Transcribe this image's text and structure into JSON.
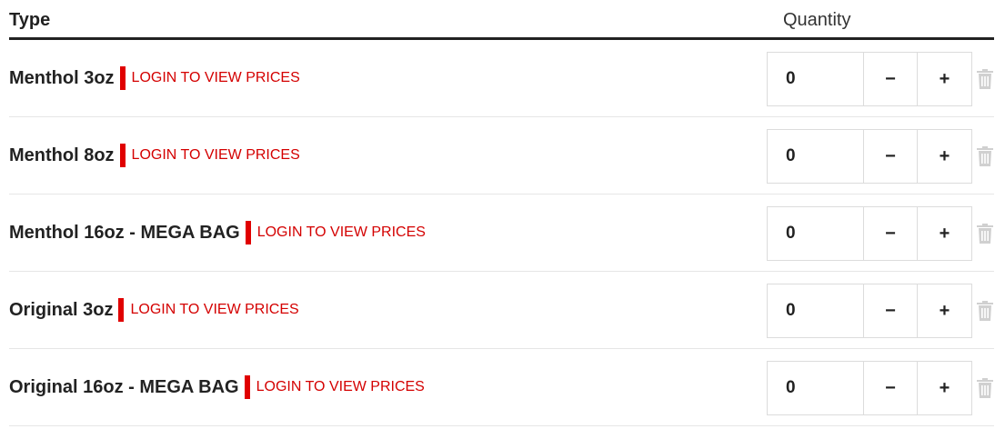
{
  "header": {
    "type_label": "Type",
    "quantity_label": "Quantity"
  },
  "rows": [
    {
      "name": "Menthol 3oz",
      "price_link": "LOGIN TO VIEW PRICES",
      "quantity": "0",
      "minus": "−",
      "plus": "+"
    },
    {
      "name": "Menthol 8oz",
      "price_link": "LOGIN TO VIEW PRICES",
      "quantity": "0",
      "minus": "−",
      "plus": "+"
    },
    {
      "name": "Menthol 16oz - MEGA BAG",
      "price_link": "LOGIN TO VIEW PRICES",
      "quantity": "0",
      "minus": "−",
      "plus": "+"
    },
    {
      "name": "Original 3oz",
      "price_link": "LOGIN TO VIEW PRICES",
      "quantity": "0",
      "minus": "−",
      "plus": "+"
    },
    {
      "name": "Original 16oz - MEGA BAG",
      "price_link": "LOGIN TO VIEW PRICES",
      "quantity": "0",
      "minus": "−",
      "plus": "+"
    }
  ],
  "icons": {
    "delete": "trash-icon"
  },
  "colors": {
    "accent_red": "#e00000",
    "link_red": "#d40000",
    "text_dark": "#222222",
    "border_light": "#dcdcdc",
    "trash_gray": "#d0d0d0"
  }
}
